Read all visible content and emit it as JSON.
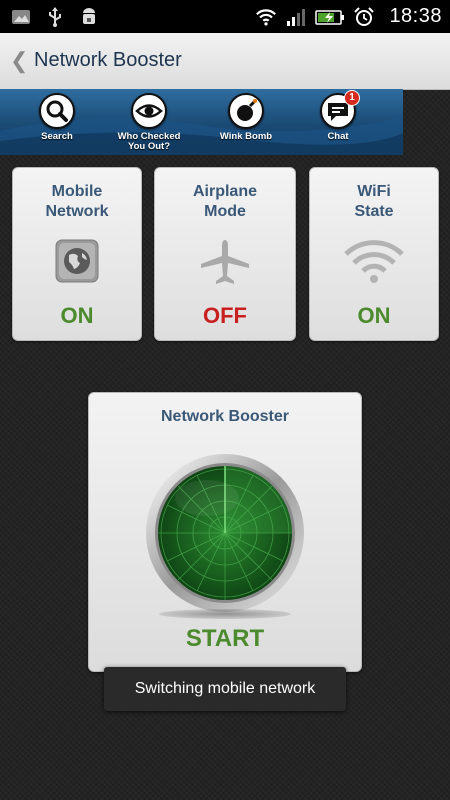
{
  "status_bar": {
    "time": "18:38",
    "icons": [
      "image-icon",
      "usb-icon",
      "android-debug-icon",
      "wifi-signal-icon",
      "cell-signal-icon",
      "battery-charging-icon",
      "alarm-icon"
    ]
  },
  "title_bar": {
    "back_icon": "chevron-left-icon",
    "title": "Network Booster"
  },
  "ad_banner": {
    "items": [
      {
        "label": "Search",
        "icon": "search-icon"
      },
      {
        "label": "Who Checked You Out?",
        "icon": "eye-icon"
      },
      {
        "label": "Wink Bomb",
        "icon": "bomb-icon"
      },
      {
        "label": "Chat",
        "icon": "chat-icon",
        "badge": "1"
      }
    ]
  },
  "tiles": [
    {
      "label_line1": "Mobile",
      "label_line2": "Network",
      "state": "ON",
      "icon": "globe-icon"
    },
    {
      "label_line1": "Airplane",
      "label_line2": "Mode",
      "state": "OFF",
      "icon": "airplane-icon"
    },
    {
      "label_line1": "WiFi",
      "label_line2": "State",
      "state": "ON",
      "icon": "wifi-icon"
    }
  ],
  "booster": {
    "title": "Network Booster",
    "action": "START",
    "icon": "radar-icon"
  },
  "toast": {
    "message": "Switching mobile network"
  },
  "colors": {
    "on": "#4c8a2e",
    "off": "#c81f1f",
    "label": "#3a5877",
    "radar": "#1f6a24"
  }
}
